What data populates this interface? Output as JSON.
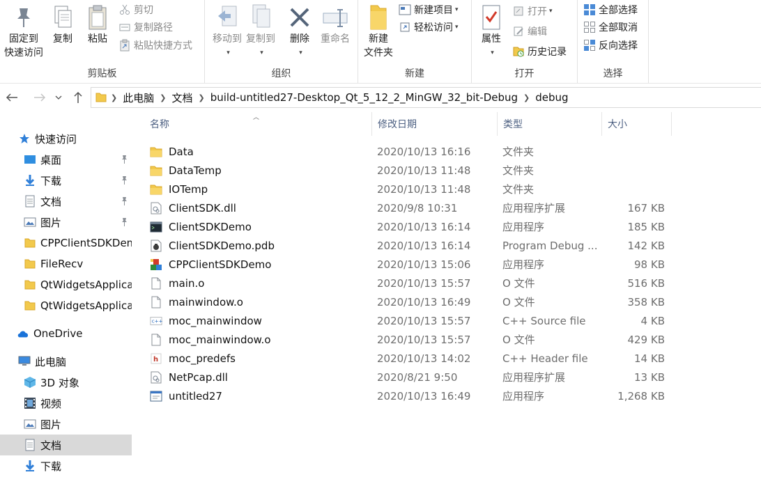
{
  "ribbon": {
    "clipboard": {
      "label": "剪贴板",
      "pin_line1": "固定到",
      "pin_line2": "快速访问",
      "copy": "复制",
      "paste": "粘贴",
      "cut": "剪切",
      "copy_path": "复制路径",
      "paste_shortcut": "粘贴快捷方式"
    },
    "organize": {
      "label": "组织",
      "move_to": "移动到",
      "copy_to": "复制到",
      "delete": "删除",
      "rename": "重命名"
    },
    "new": {
      "label": "新建",
      "new_folder_line1": "新建",
      "new_folder_line2": "文件夹",
      "new_item": "新建项目",
      "easy_access": "轻松访问"
    },
    "open": {
      "label": "打开",
      "properties": "属性",
      "open": "打开",
      "edit": "编辑",
      "history": "历史记录"
    },
    "select": {
      "label": "选择",
      "select_all": "全部选择",
      "select_none": "全部取消",
      "invert": "反向选择"
    }
  },
  "address": {
    "crumbs": [
      "此电脑",
      "文档",
      "build-untitled27-Desktop_Qt_5_12_2_MinGW_32_bit-Debug",
      "debug"
    ]
  },
  "nav": {
    "quick_access": "快速访问",
    "desktop": "桌面",
    "downloads": "下载",
    "documents": "文档",
    "pictures": "图片",
    "folder1": "CPPClientSDKDemo",
    "folder2": "FileRecv",
    "folder3": "QtWidgetsApplication",
    "folder4": "QtWidgetsApplication",
    "onedrive": "OneDrive",
    "this_pc": "此电脑",
    "objects3d": "3D 对象",
    "videos": "视频",
    "pc_pictures": "图片",
    "pc_documents": "文档",
    "pc_downloads": "下载"
  },
  "columns": {
    "name": "名称",
    "date": "修改日期",
    "type": "类型",
    "size": "大小"
  },
  "files": [
    {
      "name": "Data",
      "date": "2020/10/13 16:16",
      "type": "文件夹",
      "size": "",
      "icon": "folder-icon"
    },
    {
      "name": "DataTemp",
      "date": "2020/10/13 11:48",
      "type": "文件夹",
      "size": "",
      "icon": "folder-icon"
    },
    {
      "name": "IOTemp",
      "date": "2020/10/13 11:48",
      "type": "文件夹",
      "size": "",
      "icon": "folder-icon"
    },
    {
      "name": "ClientSDK.dll",
      "date": "2020/9/8 10:31",
      "type": "应用程序扩展",
      "size": "167 KB",
      "icon": "dll-icon"
    },
    {
      "name": "ClientSDKDemo",
      "date": "2020/10/13 16:14",
      "type": "应用程序",
      "size": "185 KB",
      "icon": "console-app-icon"
    },
    {
      "name": "ClientSDKDemo.pdb",
      "date": "2020/10/13 16:14",
      "type": "Program Debug ...",
      "size": "142 KB",
      "icon": "pdb-icon"
    },
    {
      "name": "CPPClientSDKDemo",
      "date": "2020/10/13 15:06",
      "type": "应用程序",
      "size": "98 KB",
      "icon": "app-icon"
    },
    {
      "name": "main.o",
      "date": "2020/10/13 15:57",
      "type": "O 文件",
      "size": "516 KB",
      "icon": "file-icon"
    },
    {
      "name": "mainwindow.o",
      "date": "2020/10/13 16:49",
      "type": "O 文件",
      "size": "358 KB",
      "icon": "file-icon"
    },
    {
      "name": "moc_mainwindow",
      "date": "2020/10/13 15:57",
      "type": "C++ Source file",
      "size": "4 KB",
      "icon": "cpp-icon"
    },
    {
      "name": "moc_mainwindow.o",
      "date": "2020/10/13 15:57",
      "type": "O 文件",
      "size": "429 KB",
      "icon": "file-icon"
    },
    {
      "name": "moc_predefs",
      "date": "2020/10/13 14:02",
      "type": "C++ Header file",
      "size": "14 KB",
      "icon": "header-icon"
    },
    {
      "name": "NetPcap.dll",
      "date": "2020/8/21 9:50",
      "type": "应用程序扩展",
      "size": "13 KB",
      "icon": "dll-icon"
    },
    {
      "name": "untitled27",
      "date": "2020/10/13 16:49",
      "type": "应用程序",
      "size": "1,268 KB",
      "icon": "window-app-icon"
    }
  ]
}
